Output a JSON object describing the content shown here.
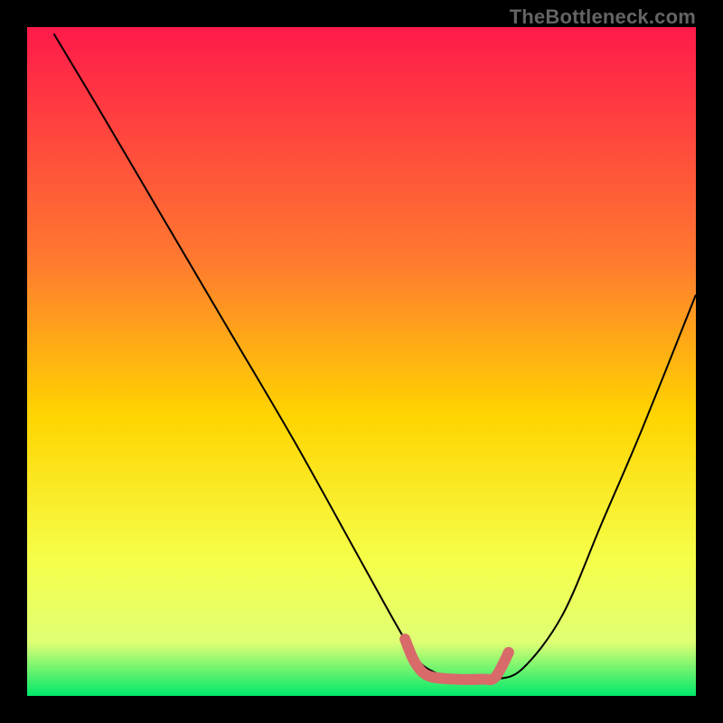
{
  "watermark": "TheBottleneck.com",
  "chart_data": {
    "type": "line",
    "title": "",
    "xlabel": "",
    "ylabel": "",
    "xlim": [
      0,
      100
    ],
    "ylim": [
      0,
      100
    ],
    "gradient_colors": {
      "top": "#ff1a4a",
      "mid1": "#ff7a2f",
      "mid2": "#ffd400",
      "mid3": "#f5ff4a",
      "mid4": "#dfff74",
      "bottom": "#00e86a"
    },
    "series": [
      {
        "name": "bottleneck-curve",
        "color": "#000000",
        "stroke_width": 2,
        "x": [
          4,
          10,
          20,
          30,
          40,
          50,
          55,
          58,
          60,
          64,
          68,
          70,
          74,
          80,
          86,
          92,
          100
        ],
        "y": [
          99,
          89,
          72,
          55,
          38,
          20,
          11,
          6,
          4,
          2.5,
          2.5,
          2.5,
          4,
          12,
          26,
          40,
          60
        ]
      },
      {
        "name": "highlight-band",
        "color": "#d86a6a",
        "stroke_width": 12,
        "linecap": "round",
        "x": [
          56.5,
          58,
          60,
          64,
          68,
          70,
          72
        ],
        "y": [
          8.5,
          5,
          3.0,
          2.5,
          2.5,
          2.8,
          6.5
        ]
      }
    ]
  }
}
